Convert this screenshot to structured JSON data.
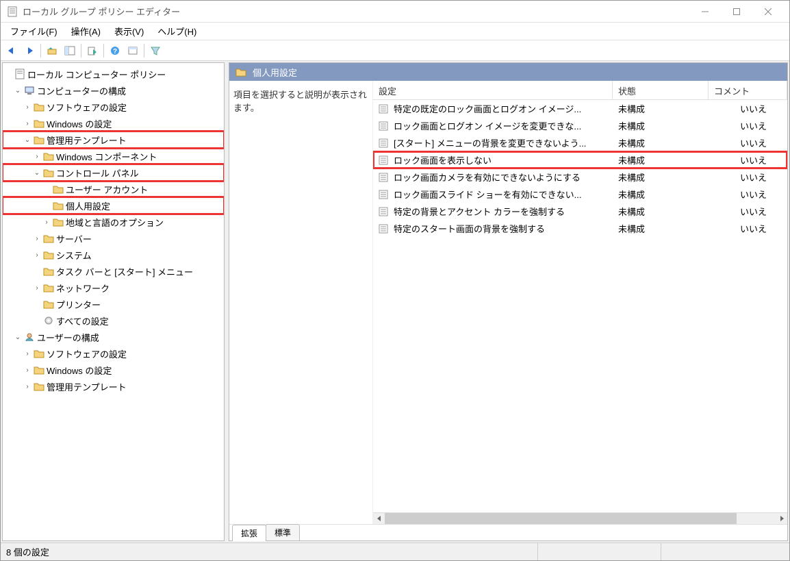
{
  "window": {
    "title": "ローカル グループ ポリシー エディター"
  },
  "menu": {
    "file": "ファイル(F)",
    "action": "操作(A)",
    "view": "表示(V)",
    "help": "ヘルプ(H)"
  },
  "tree": {
    "root": "ローカル コンピューター ポリシー",
    "comp": "コンピューターの構成",
    "sw1": "ソフトウェアの設定",
    "win1": "Windows の設定",
    "admin": "管理用テンプレート",
    "wincomp": "Windows コンポーネント",
    "cpanel": "コントロール パネル",
    "useracct": "ユーザー アカウント",
    "personal": "個人用設定",
    "region": "地域と言語のオプション",
    "server": "サーバー",
    "system": "システム",
    "taskbar": "タスク バーと [スタート] メニュー",
    "network": "ネットワーク",
    "printer": "プリンター",
    "allsettings": "すべての設定",
    "user": "ユーザーの構成",
    "sw2": "ソフトウェアの設定",
    "win2": "Windows の設定",
    "admin2": "管理用テンプレート"
  },
  "content": {
    "header": "個人用設定",
    "desc": "項目を選択すると説明が表示されます。",
    "columns": {
      "setting": "設定",
      "state": "状態",
      "comment": "コメント"
    },
    "rows": [
      {
        "name": "特定の既定のロック画面とログオン イメージ...",
        "state": "未構成",
        "comment": "いいえ",
        "hl": false
      },
      {
        "name": "ロック画面とログオン イメージを変更できな...",
        "state": "未構成",
        "comment": "いいえ",
        "hl": false
      },
      {
        "name": "[スタート] メニューの背景を変更できないよう...",
        "state": "未構成",
        "comment": "いいえ",
        "hl": false
      },
      {
        "name": "ロック画面を表示しない",
        "state": "未構成",
        "comment": "いいえ",
        "hl": true
      },
      {
        "name": "ロック画面カメラを有効にできないようにする",
        "state": "未構成",
        "comment": "いいえ",
        "hl": false
      },
      {
        "name": "ロック画面スライド ショーを有効にできない...",
        "state": "未構成",
        "comment": "いいえ",
        "hl": false
      },
      {
        "name": "特定の背景とアクセント カラーを強制する",
        "state": "未構成",
        "comment": "いいえ",
        "hl": false
      },
      {
        "name": "特定のスタート画面の背景を強制する",
        "state": "未構成",
        "comment": "いいえ",
        "hl": false
      }
    ],
    "tabs": {
      "extended": "拡張",
      "standard": "標準"
    }
  },
  "status": {
    "text": "8 個の設定"
  }
}
